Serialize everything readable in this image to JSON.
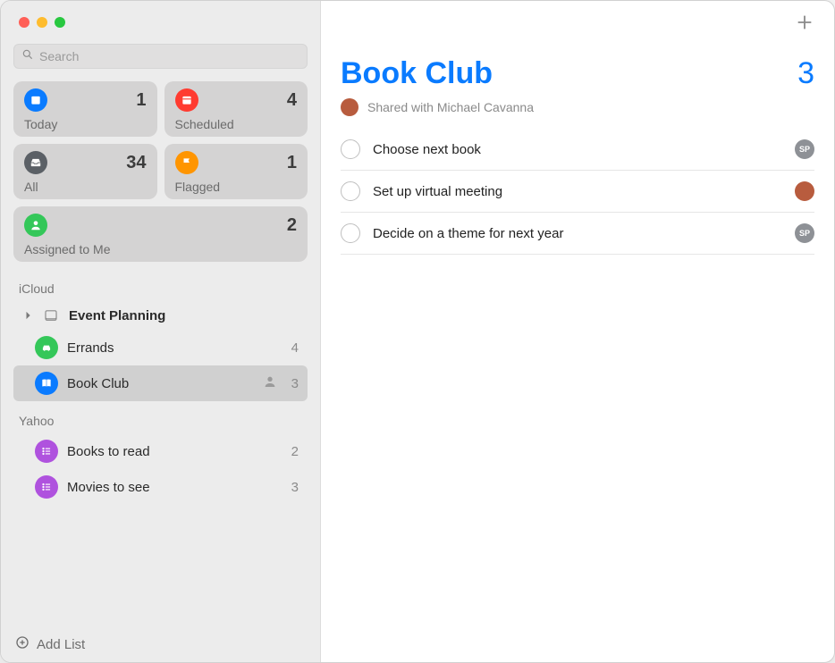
{
  "search": {
    "placeholder": "Search"
  },
  "smart_lists": {
    "today": {
      "label": "Today",
      "count": "1",
      "color": "bg-blue"
    },
    "scheduled": {
      "label": "Scheduled",
      "count": "4",
      "color": "bg-red"
    },
    "all": {
      "label": "All",
      "count": "34",
      "color": "bg-gray"
    },
    "flagged": {
      "label": "Flagged",
      "count": "1",
      "color": "bg-orange"
    },
    "assigned": {
      "label": "Assigned to Me",
      "count": "2",
      "color": "bg-green"
    }
  },
  "accounts": {
    "icloud": {
      "header": "iCloud",
      "folder": {
        "name": "Event Planning"
      },
      "lists": [
        {
          "id": "errands",
          "name": "Errands",
          "count": "4",
          "color": "bg-listgreen",
          "icon": "car",
          "shared": false,
          "selected": false
        },
        {
          "id": "bookclub",
          "name": "Book Club",
          "count": "3",
          "color": "bg-listblue",
          "icon": "book",
          "shared": true,
          "selected": true
        }
      ]
    },
    "yahoo": {
      "header": "Yahoo",
      "lists": [
        {
          "id": "books",
          "name": "Books to read",
          "count": "2",
          "color": "bg-purple",
          "icon": "list"
        },
        {
          "id": "movies",
          "name": "Movies to see",
          "count": "3",
          "color": "bg-purple",
          "icon": "list"
        }
      ]
    }
  },
  "add_list_label": "Add List",
  "main": {
    "title": "Book Club",
    "count": "3",
    "shared_with_label": "Shared with Michael Cavanna",
    "reminders": [
      {
        "text": "Choose next book",
        "assignee": "sp",
        "assignee_initials": "SP"
      },
      {
        "text": "Set up virtual meeting",
        "assignee": "mc",
        "assignee_initials": ""
      },
      {
        "text": "Decide on a theme for next year",
        "assignee": "sp",
        "assignee_initials": "SP"
      }
    ]
  }
}
